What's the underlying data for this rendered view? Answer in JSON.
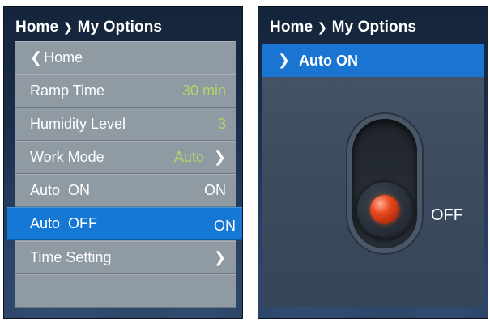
{
  "left": {
    "breadcrumb": {
      "home": "Home",
      "sep": "❯",
      "current": "My Options"
    },
    "back": {
      "chevron": "❮",
      "label": "Home"
    },
    "items": [
      {
        "label": "Ramp Time",
        "value": "30 min"
      },
      {
        "label": "Humidity Level",
        "value": "3"
      },
      {
        "label": "Work Mode",
        "value": "Auto",
        "chevron": "❯"
      },
      {
        "label": "Auto  ON",
        "value": "ON"
      },
      {
        "label": "Auto  OFF",
        "value": "ON"
      },
      {
        "label": "Time Setting",
        "chevron": "❯"
      }
    ]
  },
  "right": {
    "breadcrumb": {
      "home": "Home",
      "sep": "❯",
      "current": "My Options"
    },
    "selected": {
      "chevron": "❯",
      "label": "Auto ON"
    },
    "toggle": {
      "state": "OFF"
    }
  },
  "colors": {
    "accent": "#1478d4",
    "value_green": "#b4d36a",
    "menu_bg": "#909aa3",
    "led": "#e84a1c"
  },
  "icons": [
    "chevron-right-icon",
    "chevron-left-icon",
    "toggle-switch-icon",
    "led-indicator-icon"
  ]
}
